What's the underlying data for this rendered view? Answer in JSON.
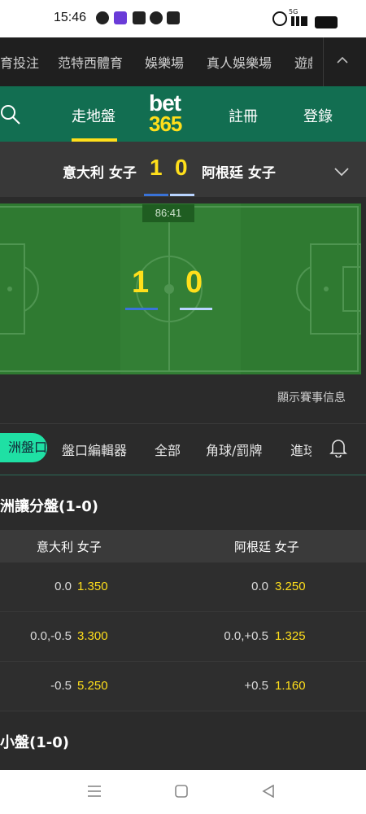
{
  "status_bar": {
    "time": "15:46",
    "network": "5G"
  },
  "top_nav": {
    "items": [
      "育投注",
      "范特西體育",
      "娛樂場",
      "真人娛樂場",
      "遊戲"
    ],
    "collapse_icon": "chevron-up-icon"
  },
  "header": {
    "search_icon": "search-icon",
    "tab_live": "走地盤",
    "logo_top": "bet",
    "logo_bottom": "365",
    "register": "註冊",
    "login": "登錄"
  },
  "match": {
    "home_team": "意大利 女子",
    "away_team": "阿根廷 女子",
    "home_score": "1",
    "away_score": "0",
    "clock": "86:41",
    "show_info": "顯示賽事信息"
  },
  "market_tabs": {
    "active": "洲盤口",
    "items": [
      "盤口編輯器",
      "全部",
      "角球/罰牌",
      "進球"
    ]
  },
  "handicap": {
    "title": "洲讓分盤(1-0)",
    "home_header": "意大利 女子",
    "away_header": "阿根廷 女子",
    "rows": [
      {
        "home_line": "0.0",
        "home_odds": "1.350",
        "away_line": "0.0",
        "away_odds": "3.250"
      },
      {
        "home_line": "0.0,-0.5",
        "home_odds": "3.300",
        "away_line": "0.0,+0.5",
        "away_odds": "1.325"
      },
      {
        "home_line": "-0.5",
        "home_odds": "5.250",
        "away_line": "+0.5",
        "away_odds": "1.160"
      }
    ]
  },
  "next_section": {
    "title": "小盤(1-0)"
  },
  "colors": {
    "brand_green": "#126e51",
    "accent_yellow": "#ffdf1b",
    "pill_green": "#1fe0a4",
    "home_bar": "#3a73d8",
    "away_bar": "#b9d4ff"
  }
}
